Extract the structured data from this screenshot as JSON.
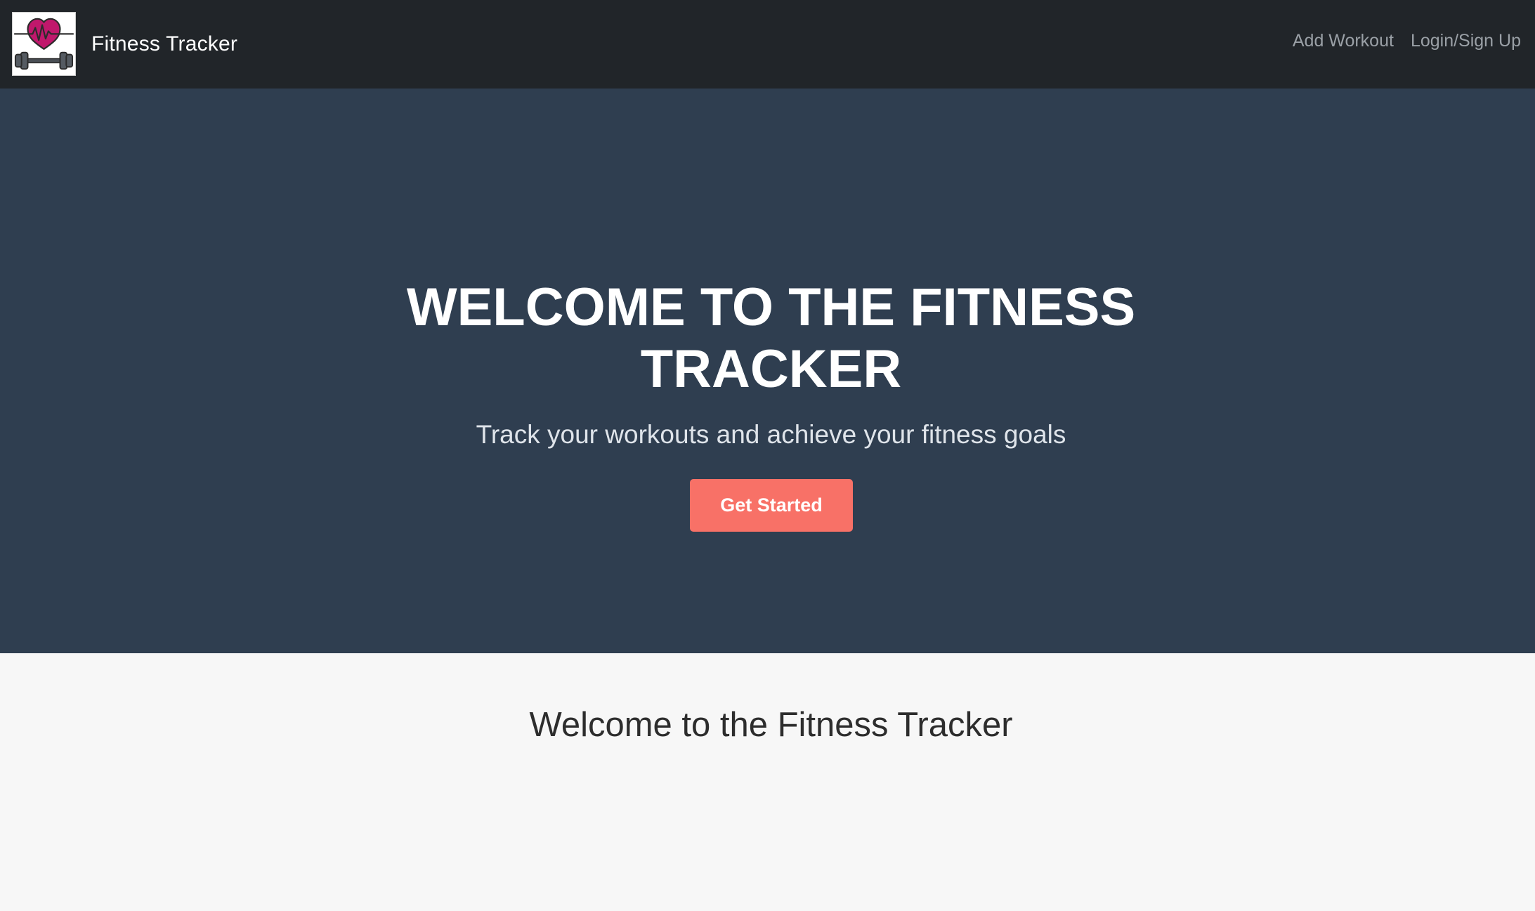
{
  "navbar": {
    "brand_name": "Fitness Tracker",
    "logo_icon": "heart-dumbbell-logo-icon",
    "links": [
      {
        "label": "Add Workout"
      },
      {
        "label": "Login/Sign Up"
      }
    ]
  },
  "hero": {
    "title_line1": "WELCOME TO THE FITNESS",
    "title_line2": "TRACKER",
    "subtitle": "Track your workouts and achieve your fitness goals",
    "cta_label": "Get Started"
  },
  "content": {
    "title": "Welcome to the Fitness Tracker"
  },
  "colors": {
    "navbar_bg": "#212529",
    "hero_bg": "#2f3e50",
    "cta_bg": "#f87167",
    "page_bg": "#f7f7f7",
    "logo_heart": "#c0186c"
  }
}
